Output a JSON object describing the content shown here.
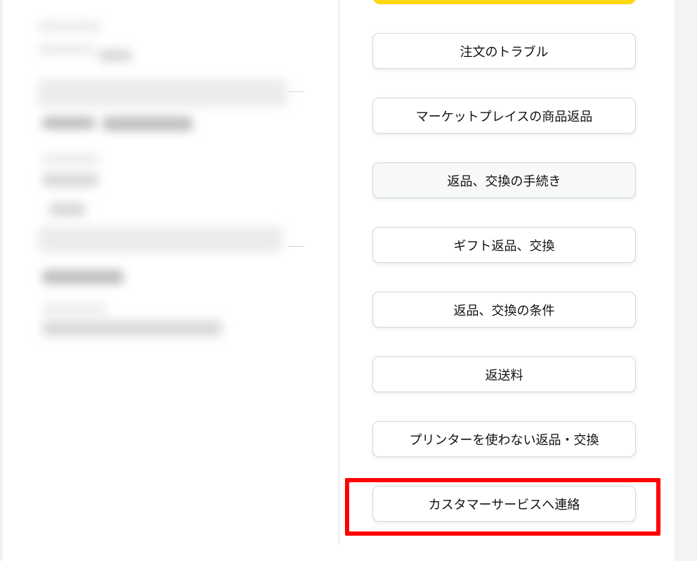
{
  "menu": {
    "items": [
      {
        "label": "注文のトラブル"
      },
      {
        "label": "マーケットプレイスの商品返品"
      },
      {
        "label": "返品、交換の手続き"
      },
      {
        "label": "ギフト返品、交換"
      },
      {
        "label": "返品、交換の条件"
      },
      {
        "label": "返送料"
      },
      {
        "label": "プリンターを使わない返品・交換"
      },
      {
        "label": "カスタマーサービスへ連絡"
      }
    ]
  },
  "colors": {
    "primary_button": "#ffd814",
    "highlight": "#ff0000",
    "button_border": "#d5d9d9",
    "text": "#0f1111"
  }
}
